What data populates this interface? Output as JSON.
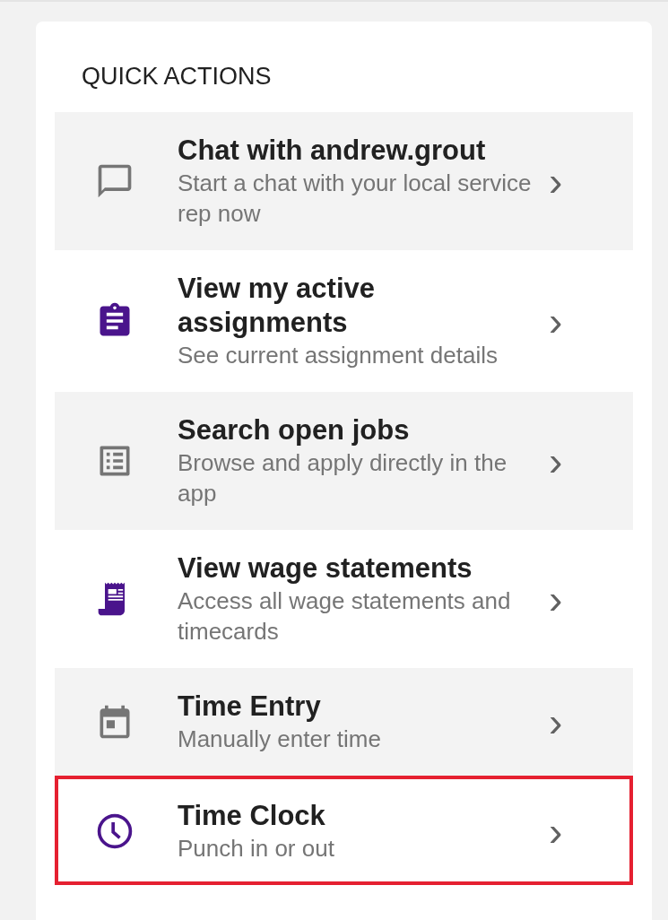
{
  "card": {
    "title": "QUICK ACTIONS",
    "items": [
      {
        "kind": "chat",
        "color": "#757575",
        "shaded": true,
        "highlighted": false,
        "title": "Chat with andrew.grout",
        "subtitle": "Start a chat with your local service rep now",
        "chevron": "›"
      },
      {
        "kind": "clipboard",
        "color": "#4a148c",
        "shaded": false,
        "highlighted": false,
        "title": "View my active assignments",
        "subtitle": "See current assignment details",
        "chevron": "›"
      },
      {
        "kind": "list",
        "color": "#757575",
        "shaded": true,
        "highlighted": false,
        "title": "Search open jobs",
        "subtitle": "Browse and apply directly in the app",
        "chevron": "›"
      },
      {
        "kind": "receipt",
        "color": "#4a148c",
        "shaded": false,
        "highlighted": false,
        "title": "View wage statements",
        "subtitle": "Access all wage statements and timecards",
        "chevron": "›"
      },
      {
        "kind": "calendar",
        "color": "#757575",
        "shaded": true,
        "highlighted": false,
        "title": "Time Entry",
        "subtitle": "Manually enter time",
        "chevron": "›"
      },
      {
        "kind": "clock",
        "color": "#4a148c",
        "shaded": false,
        "highlighted": true,
        "title": "Time Clock",
        "subtitle": "Punch in or out",
        "chevron": "›"
      }
    ]
  }
}
